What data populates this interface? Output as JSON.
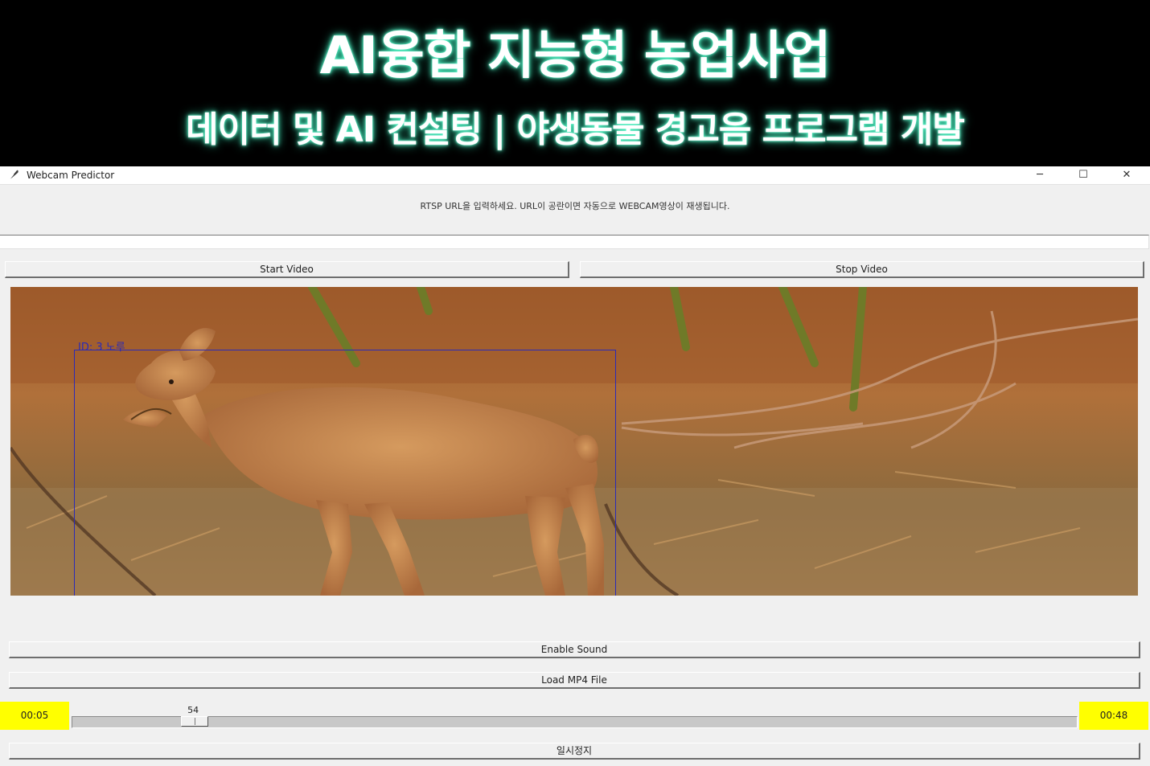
{
  "banner": {
    "title": "AI융합 지능형 농업사업",
    "subtitle": "데이터 및 AI 컨설팅 | 야생동물 경고음 프로그램 개발",
    "text_color": "#ffffff",
    "glow_color": "#3ff0c0"
  },
  "window": {
    "title": "Webcam Predictor",
    "icon": "feather-icon",
    "controls": {
      "minimize": "─",
      "maximize": "☐",
      "close": "✕"
    }
  },
  "main": {
    "instruction": "RTSP URL을 입력하세요. URL이 공란이면 자동으로 WEBCAM영상이 재생됩니다.",
    "url_value": "",
    "start_label": "Start Video",
    "stop_label": "Stop Video",
    "video": {
      "content": "roe deer walking through dry grass and leaves",
      "detection_label": "ID: 3 노루",
      "detection_color": "#2a2ab8"
    },
    "sound_label": "Enable Sound",
    "load_label": "Load MP4 File",
    "player": {
      "current_time": "00:05",
      "total_time": "00:48",
      "slider_value": "54",
      "slider_fraction": 0.112,
      "time_badge_color": "#ffff00"
    },
    "pause_label": "일시정지"
  }
}
